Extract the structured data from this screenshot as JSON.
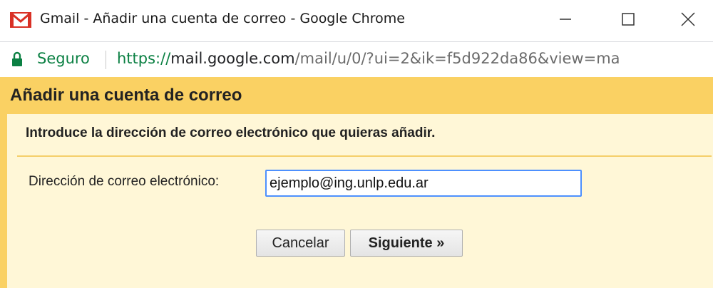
{
  "window": {
    "title": "Gmail - Añadir una cuenta de correo - Google Chrome"
  },
  "addressbar": {
    "security_label": "Seguro",
    "url_scheme": "https://",
    "url_host": "mail.google.com",
    "url_path": "/mail/u/0/?ui=2&ik=f5d922da86&view=ma"
  },
  "dialog": {
    "title": "Añadir una cuenta de correo",
    "instruction": "Introduce la dirección de correo electrónico que quieras añadir.",
    "email_label": "Dirección de correo electrónico:",
    "email_value": "ejemplo@ing.unlp.edu.ar",
    "cancel_label": "Cancelar",
    "next_label": "Siguiente »"
  },
  "icons": {
    "app": "gmail-icon",
    "lock": "lock-icon",
    "minimize": "minimize-icon",
    "maximize": "maximize-icon",
    "close": "close-icon"
  },
  "colors": {
    "dialog_header": "#fad163",
    "dialog_body": "#fff7d7",
    "secure_green": "#0b8043",
    "input_focus_border": "#4d90fe"
  }
}
